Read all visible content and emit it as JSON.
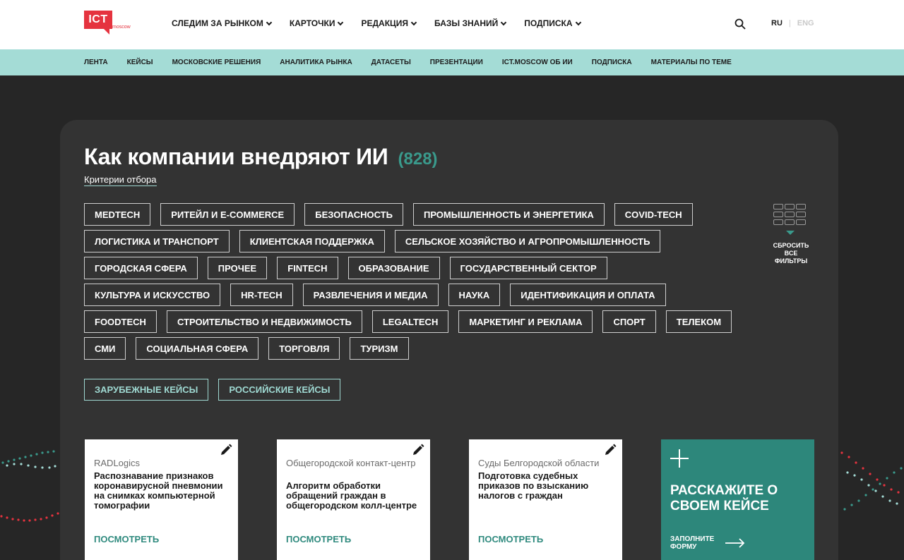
{
  "header": {
    "logo": {
      "main": "ICT",
      "sub": "moscow"
    },
    "nav": [
      {
        "label": "СЛЕДИМ ЗА РЫНКОМ"
      },
      {
        "label": "КАРТОЧКИ"
      },
      {
        "label": "РЕДАКЦИЯ"
      },
      {
        "label": "БАЗЫ ЗНАНИЙ"
      },
      {
        "label": "ПОДПИСКА"
      }
    ],
    "lang": {
      "ru": "RU",
      "separator": "|",
      "eng": "ENG"
    }
  },
  "subnav": [
    "ЛЕНТА",
    "КЕЙСЫ",
    "МОСКОВСКИЕ РЕШЕНИЯ",
    "АНАЛИТИКА РЫНКА",
    "ДАТАСЕТЫ",
    "ПРЕЗЕНТАЦИИ",
    "ICT.MOSCOW ОБ ИИ",
    "ПОДПИСКА",
    "МАТЕРИАЛЫ ПО ТЕМЕ"
  ],
  "main": {
    "title": "Как компании внедряют ИИ",
    "count": "(828)",
    "criteria": "Критерии отбора",
    "tags": [
      "MEDTECH",
      "РИТЕЙЛ И E-COMMERCE",
      "БЕЗОПАСНОСТЬ",
      "ПРОМЫШЛЕННОСТЬ И ЭНЕРГЕТИКА",
      "COVID-TECH",
      "ЛОГИСТИКА И ТРАНСПОРТ",
      "КЛИЕНТСКАЯ ПОДДЕРЖКА",
      "СЕЛЬСКОЕ ХОЗЯЙСТВО И АГРОПРОМЫШЛЕННОСТЬ",
      "ГОРОДСКАЯ СФЕРА",
      "ПРОЧЕЕ",
      "FINTECH",
      "ОБРАЗОВАНИЕ",
      "ГОСУДАРСТВЕННЫЙ СЕКТОР",
      "КУЛЬТУРА И ИСКУССТВО",
      "HR-TECH",
      "РАЗВЛЕЧЕНИЯ И МЕДИА",
      "НАУКА",
      "ИДЕНТИФИКАЦИЯ И ОПЛАТА",
      "FOODTECH",
      "СТРОИТЕЛЬСТВО И НЕДВИЖИМОСТЬ",
      "LEGALTECH",
      "МАРКЕТИНГ И РЕКЛАМА",
      "СПОРТ",
      "ТЕЛЕКОМ",
      "СМИ",
      "СОЦИАЛЬНАЯ СФЕРА",
      "ТОРГОВЛЯ",
      "ТУРИЗМ"
    ],
    "reset_label": "СБРОСИТЬ ВСЕ ФИЛЬТРЫ",
    "origin_filters": [
      "ЗАРУБЕЖНЫЕ КЕЙСЫ",
      "РОССИЙСКИЕ КЕЙСЫ"
    ]
  },
  "cards": [
    {
      "company": "RADLogics",
      "title": "Распознавание признаков коронавирусной пневмонии на снимках компьютерной томографии",
      "link": "ПОСМОТРЕТЬ"
    },
    {
      "company": "Общегородской контакт-центр",
      "title": "Алгоритм обработки обращений граждан в общегородском колл-центре",
      "link": "ПОСМОТРЕТЬ"
    },
    {
      "company": "Суды Белгородской области",
      "title": "Подготовка судебных приказов по взысканию налогов с граждан",
      "link": "ПОСМОТРЕТЬ"
    }
  ],
  "cta": {
    "title": "РАССКАЖИТЕ О СВОЕМ КЕЙСЕ",
    "link": "ЗАПОЛНИТЕ ФОРМУ"
  },
  "colors": {
    "accent": "#2d877b",
    "mint": "#a4dcd6",
    "brand_red": "#e5333f",
    "background": "#262626",
    "panel": "#333333"
  }
}
